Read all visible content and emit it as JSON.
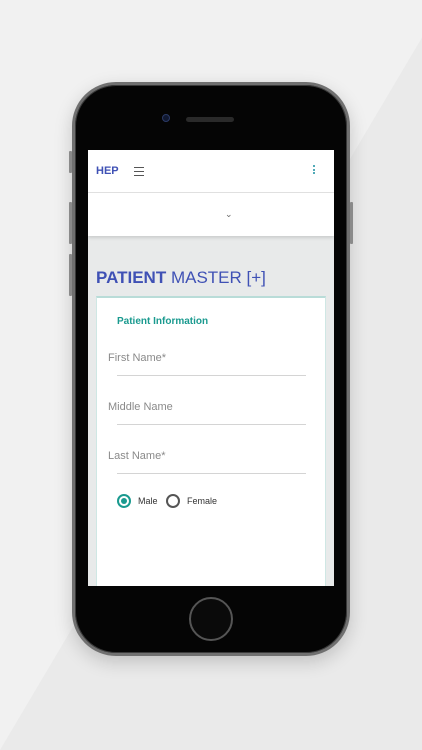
{
  "topbar": {
    "brand": "HEP",
    "menu_icon": "hamburger-menu-icon",
    "overflow_icon": "kebab-menu-icon"
  },
  "subbar": {
    "toggle_icon": "chevron-down-icon",
    "toggle_glyph": "⌄"
  },
  "page": {
    "title_bold": "PATIENT",
    "title_rest": "MASTER [+]"
  },
  "form": {
    "section_title": "Patient Information",
    "fields": [
      {
        "label": "First Name*"
      },
      {
        "label": "Middle Name"
      },
      {
        "label": "Last Name*"
      }
    ],
    "gender": {
      "options": [
        "Male",
        "Female"
      ],
      "selected": "Male"
    }
  },
  "colors": {
    "brand": "#3f51b5",
    "accent": "#1a9a8f"
  }
}
